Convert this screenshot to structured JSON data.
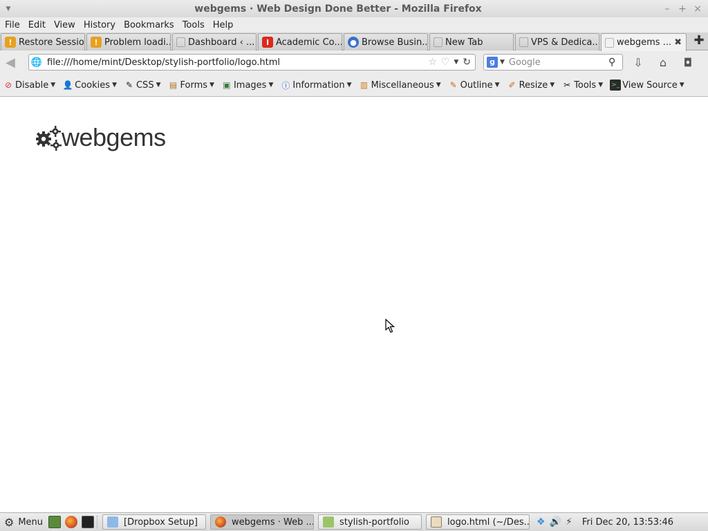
{
  "window": {
    "title": "webgems · Web Design Done Better - Mozilla Firefox"
  },
  "menubar": [
    "File",
    "Edit",
    "View",
    "History",
    "Bookmarks",
    "Tools",
    "Help"
  ],
  "tabs": [
    {
      "label": "Restore Session",
      "icon": "restore-icon"
    },
    {
      "label": "Problem loadi...",
      "icon": "restore-icon"
    },
    {
      "label": "Dashboard ‹ ...",
      "icon": "blank-page-icon"
    },
    {
      "label": "Academic Co...",
      "icon": "red-i-icon"
    },
    {
      "label": "Browse Busin...",
      "icon": "drop-icon"
    },
    {
      "label": "New Tab",
      "icon": "blank-page-icon"
    },
    {
      "label": "VPS & Dedica...",
      "icon": "blank-page-icon"
    },
    {
      "label": "webgems ...",
      "icon": "blank-page-icon",
      "active": true
    }
  ],
  "navbar": {
    "url": "file:///home/mint/Desktop/stylish-portfolio/logo.html",
    "search_placeholder": "Google"
  },
  "devbar": [
    "Disable",
    "Cookies",
    "CSS",
    "Forms",
    "Images",
    "Information",
    "Miscellaneous",
    "Outline",
    "Resize",
    "Tools",
    "View Source"
  ],
  "page": {
    "logo_text": "webgems"
  },
  "panel": {
    "menu_label": "Menu",
    "tasks": [
      {
        "label": "[Dropbox Setup]",
        "icon": "dropbox-icon"
      },
      {
        "label": "webgems · Web ...",
        "icon": "firefox-icon",
        "active": true
      },
      {
        "label": "stylish-portfolio",
        "icon": "folder-icon"
      },
      {
        "label": "logo.html (~/Des...",
        "icon": "text-editor-icon"
      }
    ],
    "clock": "Fri Dec 20, 13:53:46"
  },
  "colors": {
    "chrome": "#ececec",
    "logo": "#333333"
  }
}
